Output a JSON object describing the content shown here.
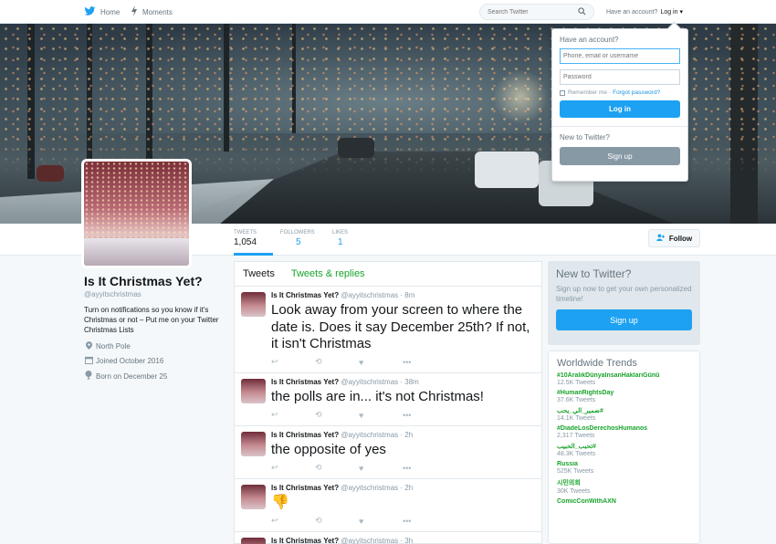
{
  "nav": {
    "home_label": "Home",
    "moments_label": "Moments",
    "search_placeholder": "Search Twitter",
    "have_account": "Have an account?",
    "login_label": "Log in"
  },
  "login_dropdown": {
    "title": "Have an account?",
    "username_placeholder": "Phone, email or username",
    "password_placeholder": "Password",
    "remember_me": "Remember me",
    "separator": "·",
    "forgot_password": "Forgot password?",
    "login_button": "Log in",
    "new_to_twitter": "New to Twitter?",
    "signup_button": "Sign up"
  },
  "stats": [
    {
      "label": "TWEETS",
      "value": "1,054"
    },
    {
      "label": "FOLLOWERS",
      "value": "5"
    },
    {
      "label": "LIKES",
      "value": "1"
    }
  ],
  "follow_button": "Follow",
  "profile": {
    "name": "Is It Christmas Yet?",
    "handle": "@ayyitschristmas",
    "bio": "Turn on notifications so you know if it's Christmas or not – Put me on your Twitter Christmas Lists",
    "location": "North Pole",
    "joined": "Joined October 2016",
    "born": "Born on December 25"
  },
  "timeline": {
    "tabs": [
      "Tweets",
      "Tweets & replies"
    ],
    "tweets": [
      {
        "name": "Is It Christmas Yet?",
        "handle": "@ayyitschristmas",
        "dot": "·",
        "time": "8m",
        "text": "Look away from your screen to where the date is. Does it say December 25th? If not, it isn't Christmas"
      },
      {
        "name": "Is It Christmas Yet?",
        "handle": "@ayyitschristmas",
        "dot": "·",
        "time": "38m",
        "text": "the polls are in... it's not Christmas!"
      },
      {
        "name": "Is It Christmas Yet?",
        "handle": "@ayyitschristmas",
        "dot": "·",
        "time": "2h",
        "text": "the opposite of yes"
      },
      {
        "name": "Is It Christmas Yet?",
        "handle": "@ayyitschristmas",
        "dot": "·",
        "time": "2h",
        "text": "👎"
      },
      {
        "name": "Is It Christmas Yet?",
        "handle": "@ayyitschristmas",
        "dot": "·",
        "time": "3h",
        "text": ""
      }
    ]
  },
  "new_to_twitter": {
    "title": "New to Twitter?",
    "subtitle": "Sign up now to get your own personalized timeline!",
    "button": "Sign up"
  },
  "trends": {
    "title": "Worldwide Trends",
    "items": [
      {
        "name": "#10AralıkDünyaİnsanHaklarıGünü",
        "count": "12.5K Tweets"
      },
      {
        "name": "#HumanRightsDay",
        "count": "37.6K Tweets"
      },
      {
        "name": "#ضمير_الي_يحب",
        "count": "14.1K Tweets"
      },
      {
        "name": "#DiadeLosDerechosHumanos",
        "count": "2,317 Tweets"
      },
      {
        "name": "#تحبب_الحبيب",
        "count": "48.3K Tweets"
      },
      {
        "name": "Russia",
        "count": "525K Tweets"
      },
      {
        "name": "시민의회",
        "count": "30K Tweets"
      },
      {
        "name": "ComicConWithAXN",
        "count": ""
      }
    ]
  },
  "colors": {
    "accent": "#1da1f2",
    "link_green": "#19a32c",
    "muted": "#8899a6"
  },
  "icons": {
    "home": "twitter-bird-icon",
    "moments": "lightning-icon",
    "search": "search-icon",
    "location": "map-pin-icon",
    "joined": "calendar-icon",
    "born": "balloon-icon",
    "reply": "reply-icon",
    "retweet": "retweet-icon",
    "like": "heart-icon",
    "more": "more-icon",
    "follow": "add-user-icon"
  }
}
